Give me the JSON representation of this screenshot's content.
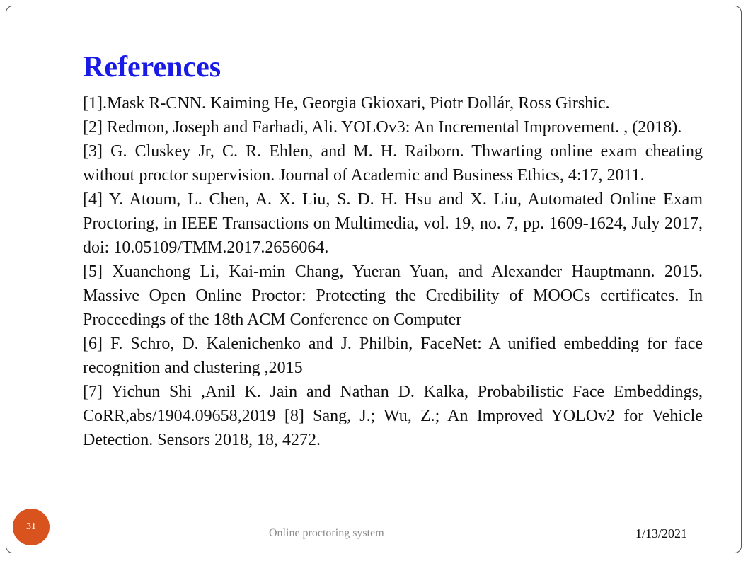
{
  "slide": {
    "title": "References",
    "references": [
      "[1].Mask R-CNN. Kaiming He, Georgia Gkioxari, Piotr Dollár, Ross Girshic.",
      "[2] Redmon, Joseph and Farhadi, Ali. YOLOv3: An Incremental Improvement. , (2018).",
      "[3] G. Cluskey Jr, C. R. Ehlen, and M. H. Raiborn. Thwarting online exam cheating without proctor supervision. Journal of Academic and Business Ethics, 4:17, 2011.",
      "[4] Y. Atoum, L. Chen, A. X. Liu, S. D. H. Hsu and X. Liu, Automated Online Exam Proctoring, in IEEE Transactions on Multimedia, vol. 19, no. 7, pp. 1609-1624, July 2017, doi: 10.05109/TMM.2017.2656064.",
      "[5] Xuanchong Li, Kai-min Chang, Yueran Yuan, and Alexander Hauptmann. 2015. Massive Open Online Proctor: Protecting the Credibility of MOOCs certificates. In Proceedings of the 18th ACM Conference on Computer",
      "[6] F. Schro, D. Kalenichenko and J. Philbin, FaceNet: A unified embedding for face recognition and clustering ,2015",
      "[7] Yichun Shi ,Anil K. Jain and Nathan D. Kalka, Probabilistic Face Embeddings, CoRR,abs/1904.09658,2019 [8] Sang, J.; Wu, Z.; An Improved YOLOv2 for Vehicle Detection. Sensors 2018, 18, 4272."
    ]
  },
  "footer": {
    "slide_number": "31",
    "text": "Online proctoring system",
    "date": "1/13/2021"
  },
  "colors": {
    "title": "#1a1ae6",
    "slide_number_badge": "#d9531e",
    "footer_text": "#8c8c8c"
  }
}
